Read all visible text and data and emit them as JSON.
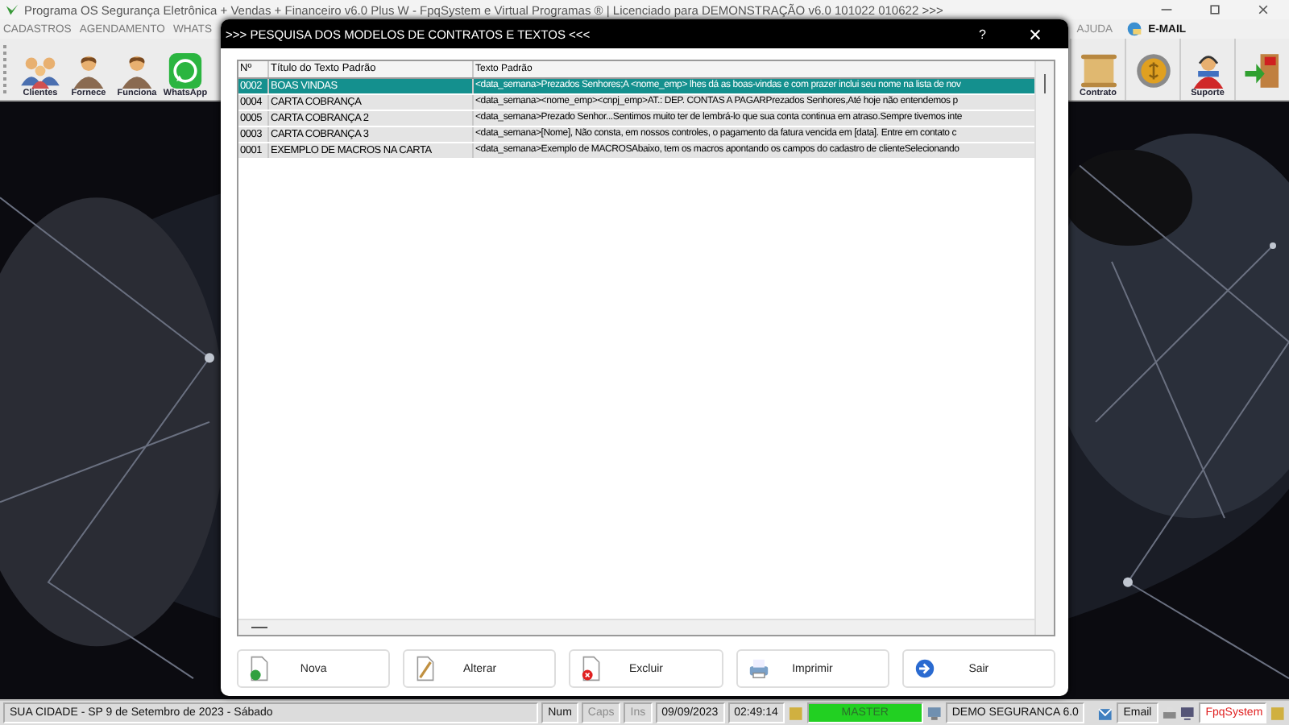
{
  "app_window": {
    "title": "Programa OS Segurança Eletrônica + Vendas + Financeiro v6.0 Plus W - FpqSystem e Virtual Programas ® | Licenciado para  DEMONSTRAÇÃO v6.0 101022 010622 >>>"
  },
  "menu_left": [
    {
      "label": "CADASTROS"
    },
    {
      "label": "AGENDAMENTO"
    },
    {
      "label": "WHATS"
    }
  ],
  "menu_right": [
    {
      "label": "AJUDA",
      "kind": "text"
    },
    {
      "label": "E-MAIL",
      "kind": "email"
    }
  ],
  "toolbar_left": [
    {
      "label": "Clientes",
      "kind": "people"
    },
    {
      "label": "Fornece",
      "kind": "person"
    },
    {
      "label": "Funciona",
      "kind": "person"
    },
    {
      "label": "WhatsApp",
      "kind": "whatsapp"
    }
  ],
  "toolbar_right": [
    {
      "label": "Contrato",
      "kind": "scroll"
    },
    {
      "kind": "coin"
    },
    {
      "label": "Suporte",
      "kind": "support"
    },
    {
      "kind": "exit"
    }
  ],
  "dialog": {
    "title": ">>> PESQUISA DOS MODELOS DE CONTRATOS E TEXTOS <<<",
    "help": "?",
    "columns": [
      "Nº",
      "Título do Texto Padrão",
      "Texto Padrão"
    ],
    "rows": [
      {
        "number": "0002",
        "title": "BOAS VINDAS",
        "text": "<data_semana>Prezados Senhores;A <nome_emp> lhes dá as boas-vindas e com prazer inclui seu nome na lista de nov",
        "selected": true
      },
      {
        "number": "0004",
        "title": "CARTA COBRANÇA",
        "text": "<data_semana><nome_emp><cnpj_emp>AT.: DEP. CONTAS A PAGARPrezados Senhores,Até hoje não entendemos p",
        "selected": false
      },
      {
        "number": "0005",
        "title": "CARTA COBRANÇA 2",
        "text": "<data_semana>Prezado Senhor...Sentimos muito ter de lembrá-lo que sua conta continua em atraso.Sempre tivemos inte",
        "selected": false
      },
      {
        "number": "0003",
        "title": "CARTA COBRANÇA 3",
        "text": "<data_semana>[Nome], Não consta, em nossos controles, o pagamento da fatura vencida em [data]. Entre em contato c",
        "selected": false
      },
      {
        "number": "0001",
        "title": "EXEMPLO DE MACROS NA CARTA",
        "text": "<data_semana>Exemplo de MACROSAbaixo, tem os macros apontando os campos do cadastro de clienteSelecionando",
        "selected": false
      }
    ],
    "buttons": [
      {
        "label": "Nova",
        "kind": "new"
      },
      {
        "label": "Alterar",
        "kind": "edit"
      },
      {
        "label": "Excluir",
        "kind": "delete"
      },
      {
        "label": "Imprimir",
        "kind": "print"
      },
      {
        "label": "Sair",
        "kind": "exit"
      }
    ]
  },
  "status_bar": {
    "location": "SUA CIDADE - SP  9 de Setembro de 2023 - Sábado",
    "keys": [
      {
        "label": "Num",
        "disabled": false
      },
      {
        "label": "Caps",
        "disabled": true
      },
      {
        "label": "Ins",
        "disabled": true
      }
    ],
    "date": "09/09/2023",
    "time": "02:49:14",
    "user": "MASTER",
    "company": "DEMO SEGURANCA 6.0",
    "email": "Email",
    "brand": "FpqSystem"
  }
}
